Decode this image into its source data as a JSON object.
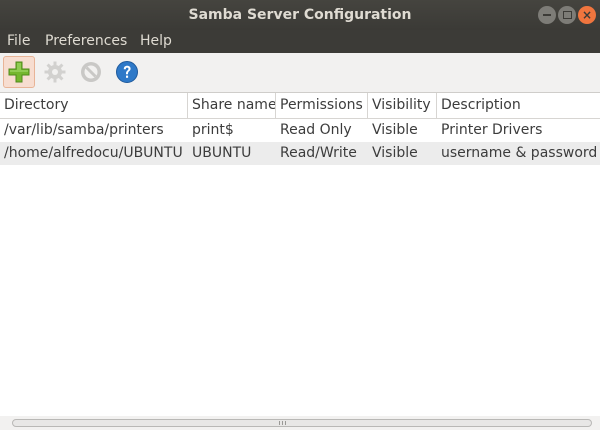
{
  "window": {
    "title": "Samba Server Configuration"
  },
  "menu": {
    "items": [
      "File",
      "Preferences",
      "Help"
    ]
  },
  "toolbar": {
    "buttons": [
      {
        "icon": "add-icon",
        "state": "active"
      },
      {
        "icon": "gear-icon",
        "state": "disabled"
      },
      {
        "icon": "delete-icon",
        "state": "disabled"
      },
      {
        "icon": "help-icon",
        "state": "enabled"
      }
    ]
  },
  "table": {
    "columns": [
      "Directory",
      "Share name",
      "Permissions",
      "Visibility",
      "Description"
    ],
    "rows": [
      [
        "/var/lib/samba/printers",
        "print$",
        "Read Only",
        "Visible",
        "Printer Drivers"
      ],
      [
        "/home/alfredocu/UBUNTU",
        "UBUNTU",
        "Read/Write",
        "Visible",
        "username & password r"
      ]
    ]
  },
  "colors": {
    "accent": "#f0753e",
    "titlebar": "#3c3b37",
    "add_icon": "#74b72e",
    "help_icon": "#2f79c8"
  }
}
